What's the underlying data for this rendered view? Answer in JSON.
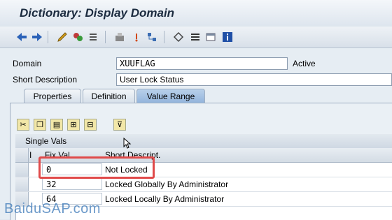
{
  "window": {
    "title": "Dictionary: Display Domain"
  },
  "toolbar": {
    "icons": [
      "back-icon",
      "forward-icon",
      "other-object-icon",
      "display-change-icon",
      "check-icon",
      "activate-icon",
      "where-used-icon",
      "navigate-icon",
      "object-list-icon",
      "hierarchy-icon",
      "display-object-list-icon",
      "info-icon"
    ]
  },
  "form": {
    "domain_label": "Domain",
    "domain_value": "XUUFLAG",
    "status": "Active",
    "short_desc_label": "Short Description",
    "short_desc_value": "User Lock Status"
  },
  "tabs": [
    {
      "label": "Properties"
    },
    {
      "label": "Definition"
    },
    {
      "label": "Value Range"
    }
  ],
  "grid": {
    "title": "Single Vals",
    "columns": [
      "I",
      "Fix.Val.",
      "Short Descript."
    ],
    "rows": [
      {
        "fix": "0",
        "desc": "Not Locked"
      },
      {
        "fix": "32",
        "desc": "Locked Globally By Administrator"
      },
      {
        "fix": "64",
        "desc": "Locked Locally By Administrator"
      }
    ]
  },
  "watermark": "BaiduSAP.com",
  "colors": {
    "accent": "#94b5dc",
    "highlight": "#e04a4a"
  }
}
